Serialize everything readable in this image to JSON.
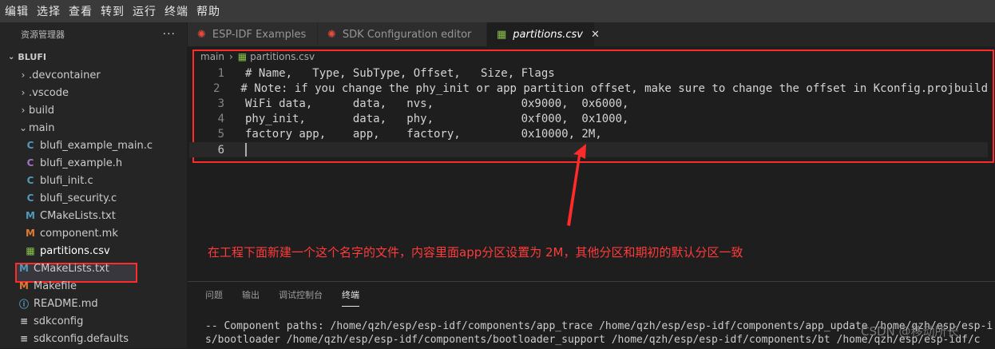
{
  "menu": [
    "编辑",
    "选择",
    "查看",
    "转到",
    "运行",
    "终端",
    "帮助"
  ],
  "sidebar": {
    "title": "资源管理器",
    "more": "···",
    "project": "BLUFI",
    "items": [
      {
        "label": ".devcontainer",
        "type": "folder"
      },
      {
        "label": ".vscode",
        "type": "folder"
      },
      {
        "label": "build",
        "type": "folder"
      },
      {
        "label": "main",
        "type": "folder-open"
      },
      {
        "label": "blufi_example_main.c",
        "icon": "C"
      },
      {
        "label": "blufi_example.h",
        "icon": "C"
      },
      {
        "label": "blufi_init.c",
        "icon": "C"
      },
      {
        "label": "blufi_security.c",
        "icon": "C"
      },
      {
        "label": "CMakeLists.txt",
        "icon": "M"
      },
      {
        "label": "component.mk",
        "icon": "M"
      },
      {
        "label": "partitions.csv",
        "icon": "csv"
      },
      {
        "label": "CMakeLists.txt",
        "icon": "M"
      },
      {
        "label": "Makefile",
        "icon": "M"
      },
      {
        "label": "README.md",
        "icon": "ⓘ"
      },
      {
        "label": "sdkconfig",
        "icon": "≡"
      },
      {
        "label": "sdkconfig.defaults",
        "icon": "≡"
      }
    ]
  },
  "tabs": [
    {
      "label": "ESP-IDF Examples"
    },
    {
      "label": "SDK Configuration editor"
    },
    {
      "label": "partitions.csv",
      "close": "✕"
    }
  ],
  "breadcrumb": {
    "folder": "main",
    "file": "partitions.csv"
  },
  "code": [
    {
      "n": "1",
      "text": "# Name,   Type, SubType, Offset,   Size, Flags"
    },
    {
      "n": "2",
      "text": "# Note: if you change the phy_init or app partition offset, make sure to change the offset in Kconfig.projbuild"
    },
    {
      "n": "3",
      "text": "WiFi data,      data,   nvs,             0x9000,  0x6000,"
    },
    {
      "n": "4",
      "text": "phy_init,       data,   phy,             0xf000,  0x1000,"
    },
    {
      "n": "5",
      "text": "factory app,    app,    factory,         0x10000, 2M,"
    },
    {
      "n": "6",
      "text": ""
    }
  ],
  "annotation": "在工程下面新建一个这个名字的文件，内容里面app分区设置为 2M，其他分区和期初的默认分区一致",
  "panel": {
    "tabs": [
      "问题",
      "输出",
      "调试控制台",
      "终端"
    ],
    "terminal": [
      "-- Component paths: /home/qzh/esp/esp-idf/components/app_trace /home/qzh/esp/esp-idf/components/app_update /home/qzh/esp/esp-i",
      "s/bootloader /home/qzh/esp/esp-idf/components/bootloader_support /home/qzh/esp/esp-idf/components/bt /home/qzh/esp/esp-idf/c"
    ]
  },
  "watermark": "CSDN @移动所长",
  "colors": {
    "highlight": "#ff2a2a",
    "csv_icon": "#89c34a",
    "c_icon": "#519aba"
  }
}
